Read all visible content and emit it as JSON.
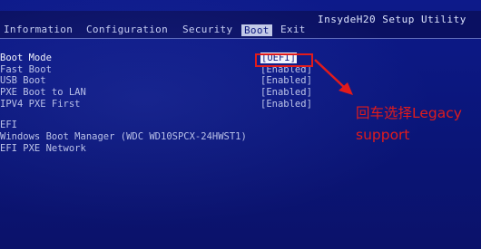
{
  "brand": "InsydeH20 Setup Utility",
  "tabs": [
    {
      "label": "Information"
    },
    {
      "label": "Configuration"
    },
    {
      "label": "Security"
    },
    {
      "label": "Boot"
    },
    {
      "label": "Exit"
    }
  ],
  "active_tab": "Boot",
  "settings": [
    {
      "label": "Boot Mode",
      "value": "[UEFI]"
    },
    {
      "label": "Fast Boot",
      "value": "[Enabled]"
    },
    {
      "label": "USB Boot",
      "value": "[Enabled]"
    },
    {
      "label": "PXE Boot to LAN",
      "value": "[Enabled]"
    },
    {
      "label": "IPV4 PXE First",
      "value": "[Enabled]"
    }
  ],
  "boot_order": {
    "heading": "EFI",
    "items": [
      "Windows Boot Manager (WDC WD10SPCX-24HWST1)",
      "EFI PXE Network"
    ]
  },
  "annotation": {
    "text": "回车选择Legacy support",
    "color": "#e21b1b"
  },
  "colors": {
    "background": "#0a1578",
    "annotation": "#e21b1b",
    "highlight": "#ffffff"
  }
}
